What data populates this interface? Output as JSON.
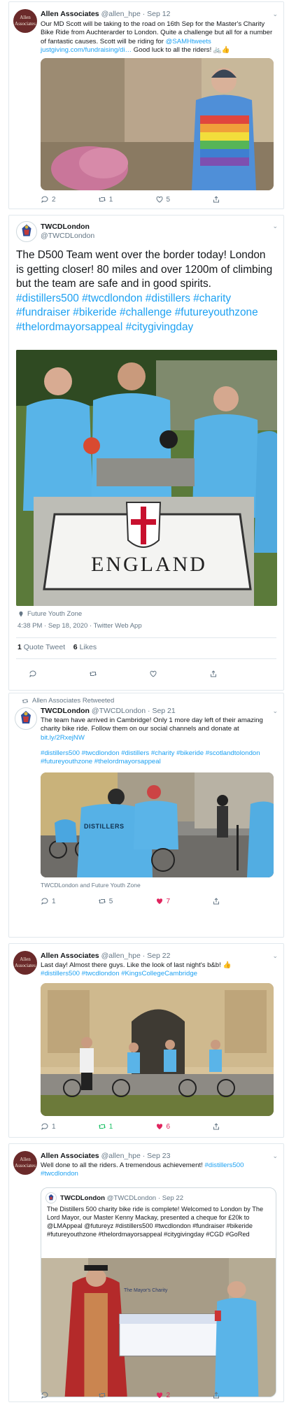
{
  "tweets": [
    {
      "avatar_text": "Allen Associates",
      "name": "Allen Associates",
      "handle": "@allen_hpe",
      "dot": "·",
      "date": "Sep 12",
      "text_parts": [
        "Our MD Scott will be taking to the road on 16th Sep for the Master's Charity Bike Ride from Auchterarder to London.  Quite a challenge but all for a number of fantastic causes.  Scott will be riding for ",
        "@SAMHtweets",
        " ",
        "justgiving.com/fundraising/di…",
        " Good luck to all the riders! 🚲👍"
      ],
      "counts": {
        "reply": "2",
        "retweet": "1",
        "like": "5"
      }
    },
    {
      "name": "TWCDLondon",
      "handle": "@TWCDLondon",
      "text_plain": "The D500 Team went over the border today! London is getting closer! 80 miles and over 1200m of climbing but the team are safe and in good spirits. ",
      "hashtags": "#distillers500 #twcdlondon #distillers #charity #fundraiser #bikeride #challenge #futureyouthzone #thelordmayorsappeal #citygivingday",
      "sign_text": "ENGLAND",
      "tagged": "Future Youth Zone",
      "timestamp": "4:38 PM · Sep 18, 2020 · Twitter Web App",
      "quote_tweets_count": "1",
      "quote_tweets_label": "Quote Tweet",
      "likes_count": "6",
      "likes_label": "Likes"
    },
    {
      "retweeted_by": "Allen Associates Retweeted",
      "name": "TWCDLondon",
      "handle": "@TWCDLondon",
      "dot": "·",
      "date": "Sep 21",
      "text_plain": "The team have arrived in Cambridge! Only 1 more day left of their amazing charity bike ride. Follow them on our social channels and donate at ",
      "link": "bit.ly/2RxejNW",
      "hashtags": "#distillers500 #twcdlondon #distillers #charity #bikeride #scotlandtolondon #futureyouthzone #thelordmayorsappeal",
      "jersey_text": "DISTILLERS",
      "tagged": "TWCDLondon and Future Youth Zone",
      "counts": {
        "reply": "1",
        "retweet": "5",
        "like": "7"
      }
    },
    {
      "avatar_text": "Allen Associates",
      "name": "Allen Associates",
      "handle": "@allen_hpe",
      "dot": "·",
      "date": "Sep 22",
      "text_plain": "Last day!  Almost there guys. Like the look of last night's b&b! 👍",
      "hashtags": "#distillers500 #twcdlondon #KingsCollegeCambridge",
      "counts": {
        "reply": "1",
        "retweet": "1",
        "like": "6"
      }
    },
    {
      "avatar_text": "Allen Associates",
      "name": "Allen Associates",
      "handle": "@allen_hpe",
      "dot": "·",
      "date": "Sep 23",
      "text_plain": "Well done to all the riders. A tremendous achievement!  ",
      "hashtags": "#distillers500 #twcdlondon",
      "quote": {
        "name": "TWCDLondon",
        "handle": "@TWCDLondon",
        "dot": "·",
        "date": "Sep 22",
        "text": "The Distillers 500 charity bike ride is complete! Welcomed to London by The Lord Mayor, our Master Kenny Mackay, presented a cheque for £20k to @LMAppeal @futureyz #distillers500 #twcdlondon #fundraiser #bikeride #futureyouthzone #thelordmayorsappeal #citygivingday #CGD #GoRed",
        "cheque_text": "The Mayor's Charity"
      },
      "counts": {
        "reply": "",
        "retweet": "",
        "like": "2"
      }
    }
  ],
  "colors": {
    "link": "#1da1f2",
    "like": "#e0245e",
    "retweet": "#17bf63",
    "meta": "#657786"
  },
  "icons": [
    "reply-icon",
    "retweet-icon",
    "like-icon",
    "share-icon",
    "chevron-down-icon",
    "location-pin-icon"
  ]
}
